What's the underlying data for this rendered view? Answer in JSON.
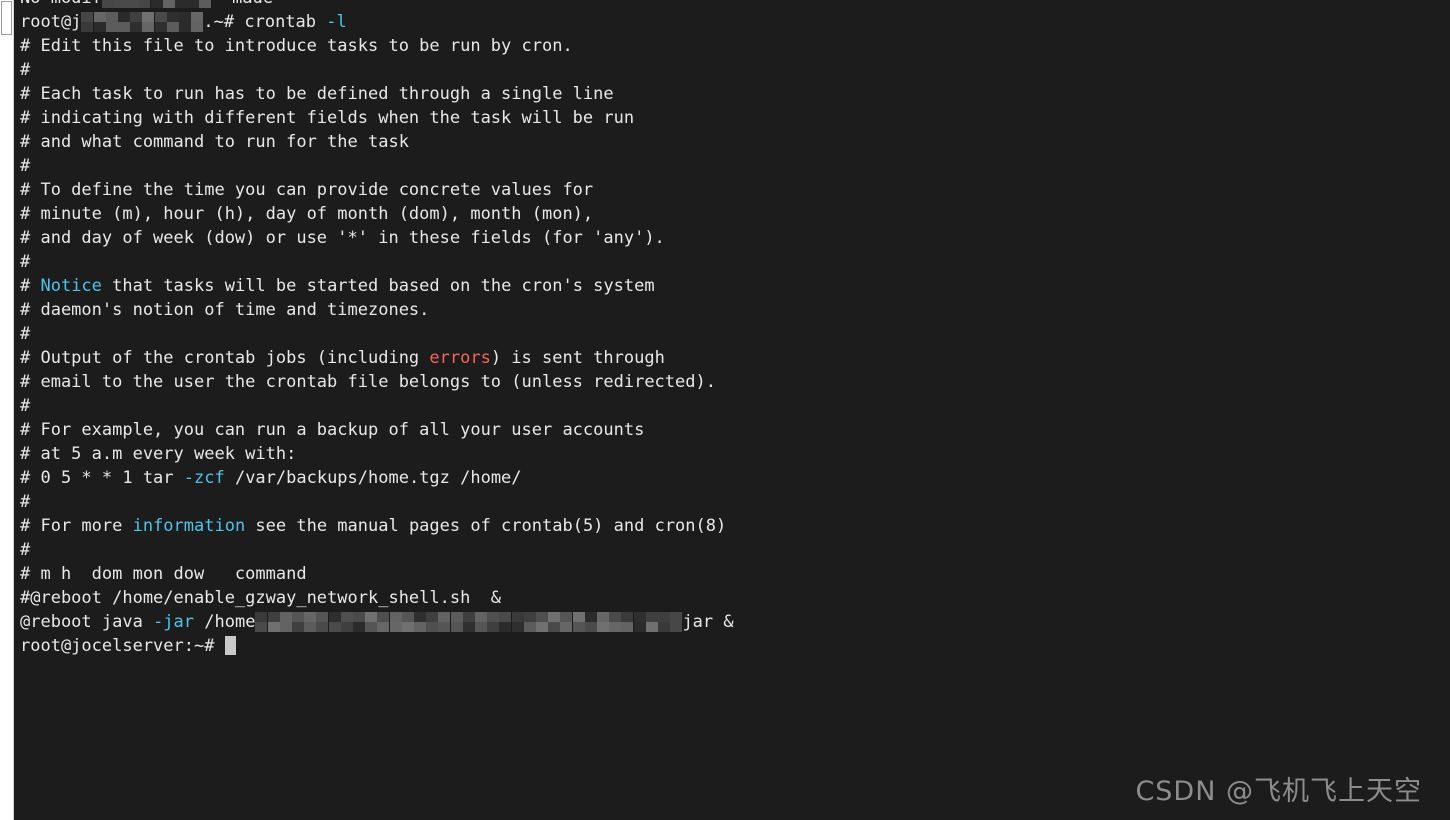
{
  "window": {
    "kind": "terminal-emulator",
    "background_color": "#1c1c1c",
    "foreground_color": "#e8e8e8",
    "accent_cyan": "#4fc3e8",
    "accent_red": "#f4665c",
    "cursor_color": "#c9c9c9"
  },
  "scrollbar": {
    "track_color": "#ffffff",
    "thumb_color": "#ffffff",
    "thumb_border_color": "#9a9a9a"
  },
  "terminal": {
    "lines": [
      {
        "id": "l00",
        "clipped": true,
        "segments": [
          {
            "text": "No modif",
            "class": "plain"
          },
          {
            "mosaic": 9
          },
          {
            "text": "  made",
            "class": "plain"
          }
        ]
      },
      {
        "id": "l01",
        "segments": [
          {
            "text": "root@j",
            "class": "plain"
          },
          {
            "mosaic": 10
          },
          {
            "text": ".~# crontab ",
            "class": "plain"
          },
          {
            "text": "-l",
            "class": "cyan"
          }
        ]
      },
      {
        "id": "l02",
        "segments": [
          {
            "text": "# Edit this file to introduce tasks to be run by cron.",
            "class": "plain"
          }
        ]
      },
      {
        "id": "l03",
        "segments": [
          {
            "text": "#",
            "class": "plain"
          }
        ]
      },
      {
        "id": "l04",
        "segments": [
          {
            "text": "# Each task to run has to be defined through a single line",
            "class": "plain"
          }
        ]
      },
      {
        "id": "l05",
        "segments": [
          {
            "text": "# indicating with different fields when the task will be run",
            "class": "plain"
          }
        ]
      },
      {
        "id": "l06",
        "segments": [
          {
            "text": "# and what command to run for the task",
            "class": "plain"
          }
        ]
      },
      {
        "id": "l07",
        "segments": [
          {
            "text": "#",
            "class": "plain"
          }
        ]
      },
      {
        "id": "l08",
        "segments": [
          {
            "text": "# To define the time you can provide concrete values for",
            "class": "plain"
          }
        ]
      },
      {
        "id": "l09",
        "segments": [
          {
            "text": "# minute (m), hour (h), day of month (dom), month (mon),",
            "class": "plain"
          }
        ]
      },
      {
        "id": "l10",
        "segments": [
          {
            "text": "# and day of week (dow) or use '*' in these fields (for 'any').",
            "class": "plain"
          }
        ]
      },
      {
        "id": "l11",
        "segments": [
          {
            "text": "#",
            "class": "plain"
          }
        ]
      },
      {
        "id": "l12",
        "segments": [
          {
            "text": "# ",
            "class": "plain"
          },
          {
            "text": "Notice",
            "class": "cyan"
          },
          {
            "text": " that tasks will be started based on the cron's system",
            "class": "plain"
          }
        ]
      },
      {
        "id": "l13",
        "segments": [
          {
            "text": "# daemon's notion of time and timezones.",
            "class": "plain"
          }
        ]
      },
      {
        "id": "l14",
        "segments": [
          {
            "text": "#",
            "class": "plain"
          }
        ]
      },
      {
        "id": "l15",
        "segments": [
          {
            "text": "# Output of the crontab jobs (including ",
            "class": "plain"
          },
          {
            "text": "errors",
            "class": "red"
          },
          {
            "text": ") is sent through",
            "class": "plain"
          }
        ]
      },
      {
        "id": "l16",
        "segments": [
          {
            "text": "# email to the user the crontab file belongs to (unless redirected).",
            "class": "plain"
          }
        ]
      },
      {
        "id": "l17",
        "segments": [
          {
            "text": "#",
            "class": "plain"
          }
        ]
      },
      {
        "id": "l18",
        "segments": [
          {
            "text": "# For example, you can run a backup of all your user accounts",
            "class": "plain"
          }
        ]
      },
      {
        "id": "l19",
        "segments": [
          {
            "text": "# at 5 a.m every week with:",
            "class": "plain"
          }
        ]
      },
      {
        "id": "l20",
        "segments": [
          {
            "text": "# 0 5 * * 1 tar ",
            "class": "plain"
          },
          {
            "text": "-zcf",
            "class": "cyan"
          },
          {
            "text": " /var/backups/home.tgz /home/",
            "class": "plain"
          }
        ]
      },
      {
        "id": "l21",
        "segments": [
          {
            "text": "#",
            "class": "plain"
          }
        ]
      },
      {
        "id": "l22",
        "segments": [
          {
            "text": "# For more ",
            "class": "plain"
          },
          {
            "text": "information",
            "class": "cyan"
          },
          {
            "text": " see the manual pages of crontab(5) and cron(8)",
            "class": "plain"
          }
        ]
      },
      {
        "id": "l23",
        "segments": [
          {
            "text": "#",
            "class": "plain"
          }
        ]
      },
      {
        "id": "l24",
        "segments": [
          {
            "text": "# m h  dom mon dow   command",
            "class": "plain"
          }
        ]
      },
      {
        "id": "l25",
        "segments": [
          {
            "text": "#@reboot /home/enable_gzway_network_shell.sh  &",
            "class": "plain"
          }
        ]
      },
      {
        "id": "l26",
        "segments": [
          {
            "text": "@reboot java ",
            "class": "plain"
          },
          {
            "text": "-jar",
            "class": "cyan"
          },
          {
            "text": " /home",
            "class": "plain"
          },
          {
            "mosaic": 35
          },
          {
            "text": "jar &",
            "class": "plain"
          }
        ]
      },
      {
        "id": "l27",
        "segments": [
          {
            "text": "root@jocelserver:~# ",
            "class": "plain"
          },
          {
            "cursor": true
          }
        ]
      }
    ]
  },
  "watermark": {
    "text": "CSDN @飞机飞上天空"
  }
}
